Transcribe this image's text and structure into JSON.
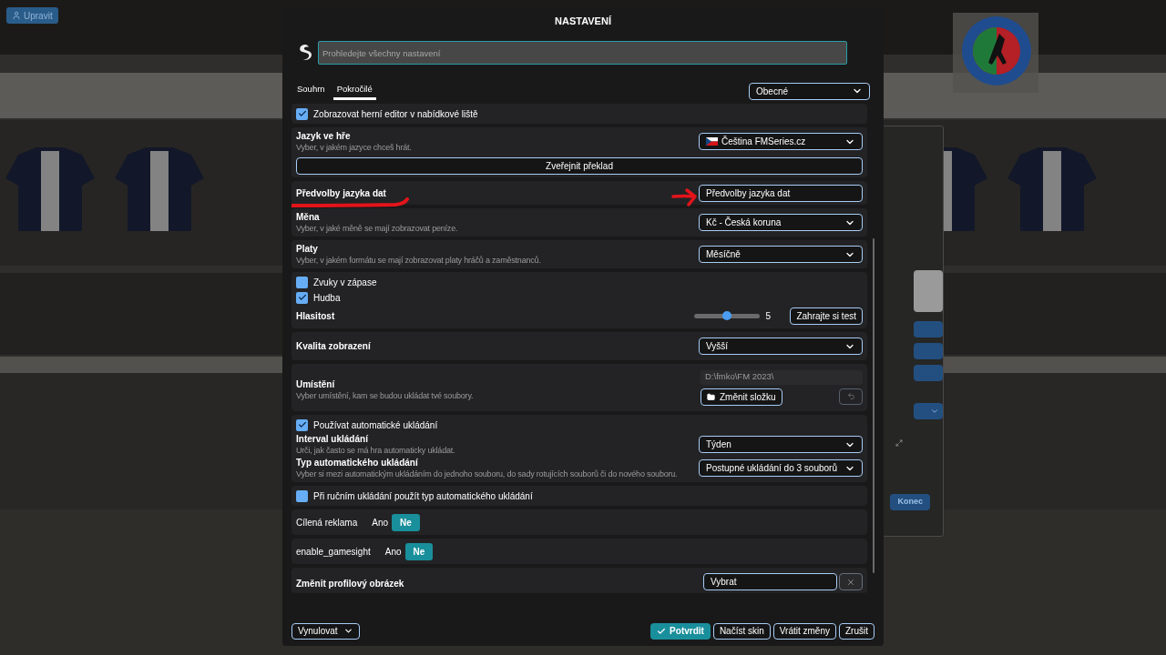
{
  "background": {
    "edit_button": "Upravit",
    "exit_button": "Konec"
  },
  "dialog": {
    "title": "NASTAVENÍ",
    "search": {
      "placeholder": "Prohledejte všechny nastavení"
    },
    "tabs": [
      {
        "label": "Souhrn",
        "selected": false
      },
      {
        "label": "Pokročilé",
        "selected": true
      }
    ],
    "category": "Obecné",
    "cards": [
      {
        "rows": [
          {
            "kind": "checkbox",
            "label": "Zobrazovat herní editor v nabídkové liště",
            "checked": true
          }
        ]
      },
      {
        "rows": [
          {
            "kind": "select",
            "title": "Jazyk ve hře",
            "description": "Vyber, v jakém jazyce chceš hrát.",
            "value": "Čeština FMSeries.cz",
            "flag": true
          },
          {
            "kind": "wide_button",
            "label": "Zveřejnit překlad"
          }
        ]
      },
      {
        "rows": [
          {
            "kind": "box",
            "title": "Předvolby jazyka dat",
            "value": "Předvolby jazyka dat",
            "annotated": true
          }
        ]
      },
      {
        "rows": [
          {
            "kind": "select",
            "title": "Měna",
            "description": "Vyber, v jaké měně se mají zobrazovat peníze.",
            "value": "Kč - Česká koruna",
            "flag": false
          }
        ]
      },
      {
        "rows": [
          {
            "kind": "select",
            "title": "Platy",
            "description": "Vyber, v jakém formátu se mají zobrazovat platy hráčů a zaměstnanců.",
            "value": "Měsíčně",
            "flag": false
          }
        ]
      },
      {
        "rows": [
          {
            "kind": "checkbox",
            "label": "Zvuky v zápase",
            "checked": false
          },
          {
            "kind": "checkbox",
            "label": "Hudba",
            "checked": true
          },
          {
            "kind": "slider",
            "title": "Hlasitost",
            "level": 0.5,
            "reading": "5",
            "button": "Zahrajte si test"
          }
        ]
      },
      {
        "rows": [
          {
            "kind": "select",
            "title": "Kvalita zobrazení",
            "value": "Vyšší",
            "flag": false
          }
        ]
      },
      {
        "rows": [
          {
            "kind": "folder",
            "title": "Umístění",
            "description": "Vyber umístění, kam se budou ukládat tvé soubory.",
            "path": "D:\\fmko\\FM 2023\\",
            "button": "Změnit složku"
          }
        ]
      },
      {
        "rows": [
          {
            "kind": "checkbox",
            "label": "Používat automatické ukládání",
            "checked": true
          },
          {
            "kind": "select",
            "title": "Interval ukládání",
            "description": "Urči, jak často se má hra automaticky ukládat.",
            "value": "Týden",
            "flag": false
          },
          {
            "kind": "select",
            "title": "Typ automatického ukládání",
            "description": "Vyber si mezi automatickým ukládáním do jednoho souboru, do sady rotujících souborů či do nového souboru.",
            "value": "Postupné ukládání do 3 souborů",
            "flag": false
          }
        ]
      },
      {
        "rows": [
          {
            "kind": "checkbox",
            "label": "Při ručním ukládání použít typ automatického ukládání",
            "checked": false
          }
        ]
      },
      {
        "rows": [
          {
            "kind": "toggle",
            "label": "Cílená reklama",
            "options": [
              {
                "label": "Ano",
                "selected": false
              },
              {
                "label": "Ne",
                "selected": true
              }
            ]
          }
        ]
      },
      {
        "rows": [
          {
            "kind": "toggle",
            "label": "enable_gamesight",
            "options": [
              {
                "label": "Ano",
                "selected": false
              },
              {
                "label": "Ne",
                "selected": true
              }
            ]
          }
        ]
      },
      {
        "rows": [
          {
            "kind": "picker",
            "title": "Změnit profilový obrázek",
            "value": "Vybrat"
          }
        ]
      }
    ],
    "footer": {
      "reset": "Vynulovat",
      "buttons": [
        {
          "label": "Potvrdit",
          "kind": "primary"
        },
        {
          "label": "Načíst skin",
          "kind": "outline"
        },
        {
          "label": "Vrátit změny",
          "kind": "outline"
        },
        {
          "label": "Zrušit",
          "kind": "outline"
        }
      ]
    }
  }
}
